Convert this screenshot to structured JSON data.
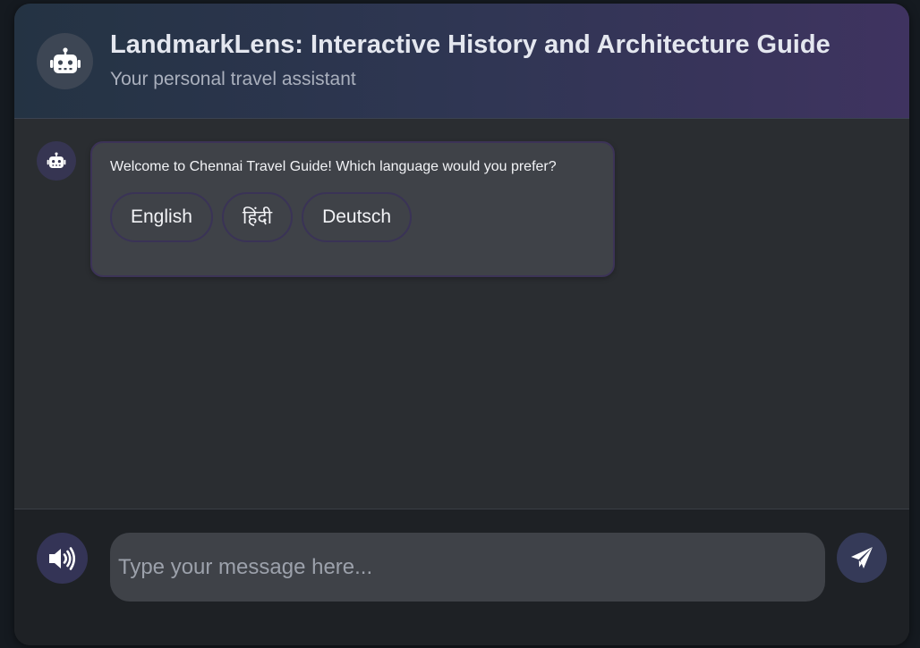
{
  "header": {
    "title": "LandmarkLens: Interactive History and Architecture Guide",
    "subtitle": "Your personal travel assistant",
    "avatar_icon": "robot-icon"
  },
  "chat": {
    "messages": [
      {
        "sender": "bot",
        "avatar_icon": "robot-icon",
        "text": "Welcome to Chennai Travel Guide! Which language would you prefer?",
        "options": [
          "English",
          "हिंदी",
          "Deutsch"
        ]
      }
    ]
  },
  "footer": {
    "speaker_icon": "speaker-icon",
    "input": {
      "placeholder": "Type your message here...",
      "value": ""
    },
    "send_icon": "paper-plane-icon"
  },
  "colors": {
    "header_gradient_start": "#243343",
    "header_gradient_end": "#3f3360",
    "accent_purple": "#3c3357",
    "chat_background": "#2a2d31",
    "bubble_background": "#3f4248"
  }
}
